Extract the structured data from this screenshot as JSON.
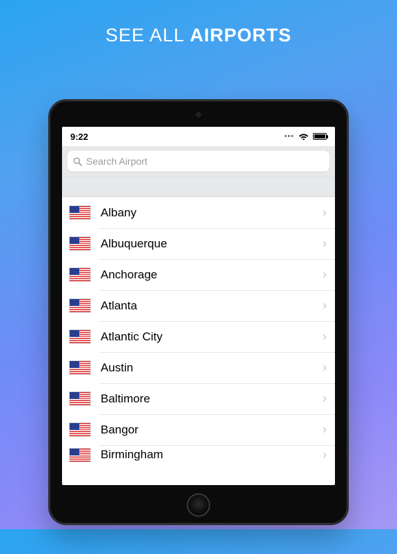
{
  "hero": {
    "prefix": "SEE ALL ",
    "emph": "AIRPORTS"
  },
  "statusbar": {
    "time": "9:22"
  },
  "search": {
    "placeholder": "Search Airport"
  },
  "airports": {
    "items": [
      {
        "label": "Albany"
      },
      {
        "label": "Albuquerque"
      },
      {
        "label": "Anchorage"
      },
      {
        "label": "Atlanta"
      },
      {
        "label": "Atlantic City"
      },
      {
        "label": "Austin"
      },
      {
        "label": "Baltimore"
      },
      {
        "label": "Bangor"
      },
      {
        "label": "Birmingham"
      }
    ]
  }
}
